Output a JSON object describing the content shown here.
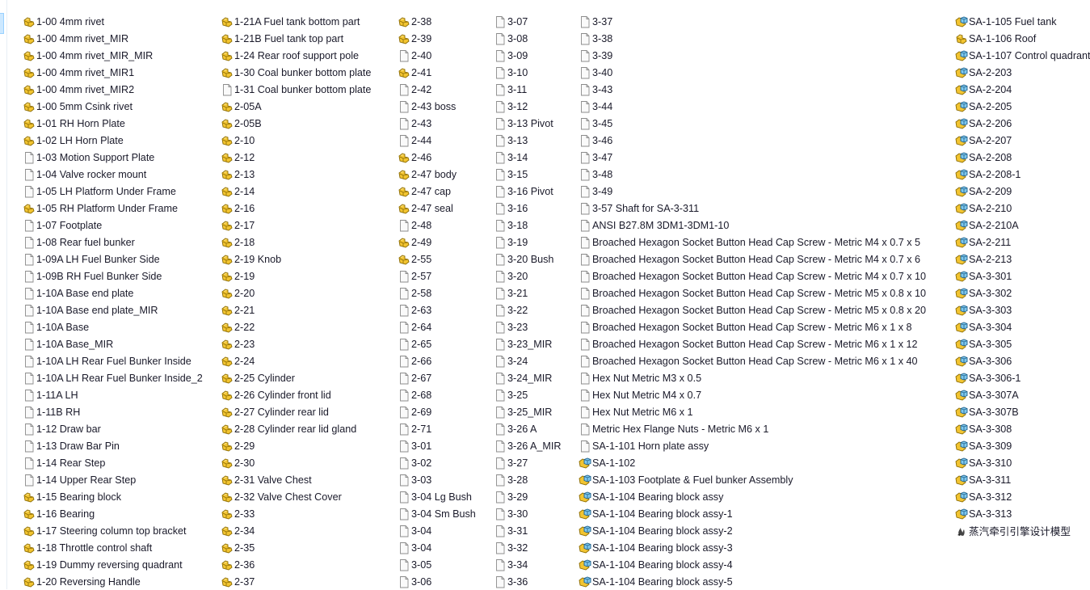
{
  "colors": {
    "part": "#e8b820",
    "assembly_cube": "#5ab4e0",
    "text": "#1a1a2a",
    "selection": "#cce8ff"
  },
  "columns": [
    [
      {
        "name": "1-00 4mm rivet",
        "icon": "part"
      },
      {
        "name": "1-00 4mm rivet_MIR",
        "icon": "part"
      },
      {
        "name": "1-00 4mm rivet_MIR_MIR",
        "icon": "part"
      },
      {
        "name": "1-00 4mm rivet_MIR1",
        "icon": "part"
      },
      {
        "name": "1-00 4mm rivet_MIR2",
        "icon": "part"
      },
      {
        "name": "1-00 5mm Csink rivet",
        "icon": "part"
      },
      {
        "name": "1-01 RH Horn Plate",
        "icon": "part"
      },
      {
        "name": "1-02 LH Horn Plate",
        "icon": "part"
      },
      {
        "name": "1-03 Motion Support Plate",
        "icon": "doc"
      },
      {
        "name": "1-04 Valve rocker mount",
        "icon": "doc"
      },
      {
        "name": "1-05 LH Platform Under Frame",
        "icon": "doc"
      },
      {
        "name": "1-05 RH Platform Under Frame",
        "icon": "part"
      },
      {
        "name": "1-07 Footplate",
        "icon": "doc"
      },
      {
        "name": "1-08 Rear fuel bunker",
        "icon": "doc"
      },
      {
        "name": "1-09A LH Fuel Bunker Side",
        "icon": "doc"
      },
      {
        "name": "1-09B RH Fuel Bunker Side",
        "icon": "doc"
      },
      {
        "name": "1-10A Base end plate",
        "icon": "doc"
      },
      {
        "name": "1-10A Base end plate_MIR",
        "icon": "doc"
      },
      {
        "name": "1-10A Base",
        "icon": "doc"
      },
      {
        "name": "1-10A Base_MIR",
        "icon": "doc"
      },
      {
        "name": "1-10A LH Rear Fuel Bunker Inside",
        "icon": "doc"
      },
      {
        "name": "1-10A LH Rear Fuel Bunker Inside_2",
        "icon": "doc"
      },
      {
        "name": "1-11A LH",
        "icon": "doc"
      },
      {
        "name": "1-11B RH",
        "icon": "doc"
      },
      {
        "name": "1-12 Draw bar",
        "icon": "doc"
      },
      {
        "name": "1-13 Draw Bar Pin",
        "icon": "doc"
      },
      {
        "name": "1-14 Rear Step",
        "icon": "doc"
      },
      {
        "name": "1-14 Upper Rear Step",
        "icon": "doc"
      },
      {
        "name": "1-15 Bearing block",
        "icon": "part"
      },
      {
        "name": "1-16 Bearing",
        "icon": "part"
      },
      {
        "name": "1-17 Steering column top bracket",
        "icon": "part"
      },
      {
        "name": "1-18 Throttle control shaft",
        "icon": "part"
      },
      {
        "name": "1-19 Dummy reversing quadrant",
        "icon": "part"
      },
      {
        "name": "1-20 Reversing Handle",
        "icon": "part"
      }
    ],
    [
      {
        "name": "1-21A Fuel tank bottom part",
        "icon": "part"
      },
      {
        "name": "1-21B Fuel tank top part",
        "icon": "part"
      },
      {
        "name": "1-24 Rear roof support pole",
        "icon": "part"
      },
      {
        "name": "1-30 Coal bunker bottom plate",
        "icon": "part"
      },
      {
        "name": "1-31 Coal bunker bottom plate",
        "icon": "doc"
      },
      {
        "name": "2-05A",
        "icon": "part"
      },
      {
        "name": "2-05B",
        "icon": "part"
      },
      {
        "name": "2-10",
        "icon": "part"
      },
      {
        "name": "2-12",
        "icon": "part"
      },
      {
        "name": "2-13",
        "icon": "part"
      },
      {
        "name": "2-14",
        "icon": "part"
      },
      {
        "name": "2-16",
        "icon": "part"
      },
      {
        "name": "2-17",
        "icon": "part"
      },
      {
        "name": "2-18",
        "icon": "part"
      },
      {
        "name": "2-19 Knob",
        "icon": "part"
      },
      {
        "name": "2-19",
        "icon": "part"
      },
      {
        "name": "2-20",
        "icon": "part"
      },
      {
        "name": "2-21",
        "icon": "part"
      },
      {
        "name": "2-22",
        "icon": "part"
      },
      {
        "name": "2-23",
        "icon": "part"
      },
      {
        "name": "2-24",
        "icon": "part"
      },
      {
        "name": "2-25 Cylinder",
        "icon": "part"
      },
      {
        "name": "2-26 Cylinder front lid",
        "icon": "part"
      },
      {
        "name": "2-27 Cylinder rear lid",
        "icon": "part"
      },
      {
        "name": "2-28 Cylinder rear lid gland",
        "icon": "part"
      },
      {
        "name": "2-29",
        "icon": "part"
      },
      {
        "name": "2-30",
        "icon": "part"
      },
      {
        "name": "2-31 Valve Chest",
        "icon": "part"
      },
      {
        "name": "2-32 Valve Chest Cover",
        "icon": "part"
      },
      {
        "name": "2-33",
        "icon": "part"
      },
      {
        "name": "2-34",
        "icon": "part"
      },
      {
        "name": "2-35",
        "icon": "part"
      },
      {
        "name": "2-36",
        "icon": "part"
      },
      {
        "name": "2-37",
        "icon": "part"
      }
    ],
    [
      {
        "name": "2-38",
        "icon": "part"
      },
      {
        "name": "2-39",
        "icon": "part"
      },
      {
        "name": "2-40",
        "icon": "doc"
      },
      {
        "name": "2-41",
        "icon": "part"
      },
      {
        "name": "2-42",
        "icon": "doc"
      },
      {
        "name": "2-43 boss",
        "icon": "doc"
      },
      {
        "name": "2-43",
        "icon": "doc"
      },
      {
        "name": "2-44",
        "icon": "doc"
      },
      {
        "name": "2-46",
        "icon": "part"
      },
      {
        "name": "2-47 body",
        "icon": "part"
      },
      {
        "name": "2-47 cap",
        "icon": "part"
      },
      {
        "name": "2-47 seal",
        "icon": "part"
      },
      {
        "name": "2-48",
        "icon": "doc"
      },
      {
        "name": "2-49",
        "icon": "part"
      },
      {
        "name": "2-55",
        "icon": "part"
      },
      {
        "name": "2-57",
        "icon": "doc"
      },
      {
        "name": "2-58",
        "icon": "doc"
      },
      {
        "name": "2-63",
        "icon": "doc"
      },
      {
        "name": "2-64",
        "icon": "doc"
      },
      {
        "name": "2-65",
        "icon": "doc"
      },
      {
        "name": "2-66",
        "icon": "doc"
      },
      {
        "name": "2-67",
        "icon": "doc"
      },
      {
        "name": "2-68",
        "icon": "doc"
      },
      {
        "name": "2-69",
        "icon": "doc"
      },
      {
        "name": "2-71",
        "icon": "doc"
      },
      {
        "name": "3-01",
        "icon": "doc"
      },
      {
        "name": "3-02",
        "icon": "doc"
      },
      {
        "name": "3-03",
        "icon": "doc"
      },
      {
        "name": "3-04 Lg Bush",
        "icon": "doc"
      },
      {
        "name": "3-04 Sm Bush",
        "icon": "doc"
      },
      {
        "name": "3-04",
        "icon": "doc"
      },
      {
        "name": "3-04",
        "icon": "doc"
      },
      {
        "name": "3-05",
        "icon": "doc"
      },
      {
        "name": "3-06",
        "icon": "doc"
      }
    ],
    [
      {
        "name": "3-07",
        "icon": "doc"
      },
      {
        "name": "3-08",
        "icon": "doc"
      },
      {
        "name": "3-09",
        "icon": "doc"
      },
      {
        "name": "3-10",
        "icon": "doc"
      },
      {
        "name": "3-11",
        "icon": "doc"
      },
      {
        "name": "3-12",
        "icon": "doc"
      },
      {
        "name": "3-13 Pivot",
        "icon": "doc"
      },
      {
        "name": "3-13",
        "icon": "doc"
      },
      {
        "name": "3-14",
        "icon": "doc"
      },
      {
        "name": "3-15",
        "icon": "doc"
      },
      {
        "name": "3-16 Pivot",
        "icon": "doc"
      },
      {
        "name": "3-16",
        "icon": "doc"
      },
      {
        "name": "3-18",
        "icon": "doc"
      },
      {
        "name": "3-19",
        "icon": "doc"
      },
      {
        "name": "3-20 Bush",
        "icon": "doc"
      },
      {
        "name": "3-20",
        "icon": "doc"
      },
      {
        "name": "3-21",
        "icon": "doc"
      },
      {
        "name": "3-22",
        "icon": "doc"
      },
      {
        "name": "3-23",
        "icon": "doc"
      },
      {
        "name": "3-23_MIR",
        "icon": "doc"
      },
      {
        "name": "3-24",
        "icon": "doc"
      },
      {
        "name": "3-24_MIR",
        "icon": "doc"
      },
      {
        "name": "3-25",
        "icon": "doc"
      },
      {
        "name": "3-25_MIR",
        "icon": "doc"
      },
      {
        "name": "3-26 A",
        "icon": "doc"
      },
      {
        "name": "3-26 A_MIR",
        "icon": "doc"
      },
      {
        "name": "3-27",
        "icon": "doc"
      },
      {
        "name": "3-28",
        "icon": "doc"
      },
      {
        "name": "3-29",
        "icon": "doc"
      },
      {
        "name": "3-30",
        "icon": "doc"
      },
      {
        "name": "3-31",
        "icon": "doc"
      },
      {
        "name": "3-32",
        "icon": "doc"
      },
      {
        "name": "3-34",
        "icon": "doc"
      },
      {
        "name": "3-36",
        "icon": "doc"
      }
    ],
    [
      {
        "name": "3-37",
        "icon": "doc"
      },
      {
        "name": "3-38",
        "icon": "doc"
      },
      {
        "name": "3-39",
        "icon": "doc"
      },
      {
        "name": "3-40",
        "icon": "doc"
      },
      {
        "name": "3-43",
        "icon": "doc"
      },
      {
        "name": "3-44",
        "icon": "doc"
      },
      {
        "name": "3-45",
        "icon": "doc"
      },
      {
        "name": "3-46",
        "icon": "doc"
      },
      {
        "name": "3-47",
        "icon": "doc"
      },
      {
        "name": "3-48",
        "icon": "doc"
      },
      {
        "name": "3-49",
        "icon": "doc"
      },
      {
        "name": "3-57 Shaft for SA-3-311",
        "icon": "doc"
      },
      {
        "name": "ANSI B27.8M 3DM1-3DM1-10",
        "icon": "doc"
      },
      {
        "name": "Broached Hexagon Socket Button Head Cap Screw - Metric M4 x 0.7 x 5",
        "icon": "doc"
      },
      {
        "name": "Broached Hexagon Socket Button Head Cap Screw - Metric M4 x 0.7 x 6",
        "icon": "doc"
      },
      {
        "name": "Broached Hexagon Socket Button Head Cap Screw - Metric M4 x 0.7 x 10",
        "icon": "doc"
      },
      {
        "name": "Broached Hexagon Socket Button Head Cap Screw - Metric M5 x 0.8 x 10",
        "icon": "doc"
      },
      {
        "name": "Broached Hexagon Socket Button Head Cap Screw - Metric M5 x 0.8 x 20",
        "icon": "doc"
      },
      {
        "name": "Broached Hexagon Socket Button Head Cap Screw - Metric M6 x 1 x 8",
        "icon": "doc"
      },
      {
        "name": "Broached Hexagon Socket Button Head Cap Screw - Metric M6 x 1 x 12",
        "icon": "doc"
      },
      {
        "name": "Broached Hexagon Socket Button Head Cap Screw - Metric M6 x 1 x 40",
        "icon": "doc"
      },
      {
        "name": "Hex Nut Metric M3 x 0.5",
        "icon": "doc"
      },
      {
        "name": "Hex Nut Metric M4 x 0.7",
        "icon": "doc"
      },
      {
        "name": "Hex Nut Metric M6 x 1",
        "icon": "doc"
      },
      {
        "name": "Metric Hex Flange Nuts - Metric M6 x 1",
        "icon": "doc"
      },
      {
        "name": "SA-1-101 Horn plate assy",
        "icon": "doc"
      },
      {
        "name": "SA-1-102",
        "icon": "assembly"
      },
      {
        "name": "SA-1-103 Footplate & Fuel bunker Assembly",
        "icon": "assembly"
      },
      {
        "name": "SA-1-104 Bearing block assy",
        "icon": "assembly"
      },
      {
        "name": "SA-1-104 Bearing block assy-1",
        "icon": "assembly"
      },
      {
        "name": "SA-1-104 Bearing block assy-2",
        "icon": "assembly"
      },
      {
        "name": "SA-1-104 Bearing block assy-3",
        "icon": "assembly"
      },
      {
        "name": "SA-1-104 Bearing block assy-4",
        "icon": "assembly"
      },
      {
        "name": "SA-1-104 Bearing block assy-5",
        "icon": "assembly"
      }
    ],
    [
      {
        "name": "SA-1-105 Fuel tank",
        "icon": "assembly"
      },
      {
        "name": "SA-1-106 Roof",
        "icon": "part"
      },
      {
        "name": "SA-1-107 Control quadrant",
        "icon": "assembly"
      },
      {
        "name": "SA-2-203",
        "icon": "assembly"
      },
      {
        "name": "SA-2-204",
        "icon": "assembly"
      },
      {
        "name": "SA-2-205",
        "icon": "assembly"
      },
      {
        "name": "SA-2-206",
        "icon": "assembly"
      },
      {
        "name": "SA-2-207",
        "icon": "assembly"
      },
      {
        "name": "SA-2-208",
        "icon": "assembly"
      },
      {
        "name": "SA-2-208-1",
        "icon": "assembly"
      },
      {
        "name": "SA-2-209",
        "icon": "assembly"
      },
      {
        "name": "SA-2-210",
        "icon": "assembly"
      },
      {
        "name": "SA-2-210A",
        "icon": "assembly"
      },
      {
        "name": "SA-2-211",
        "icon": "assembly"
      },
      {
        "name": "SA-2-213",
        "icon": "assembly"
      },
      {
        "name": "SA-3-301",
        "icon": "assembly"
      },
      {
        "name": "SA-3-302",
        "icon": "assembly"
      },
      {
        "name": "SA-3-303",
        "icon": "assembly"
      },
      {
        "name": "SA-3-304",
        "icon": "assembly"
      },
      {
        "name": "SA-3-305",
        "icon": "assembly"
      },
      {
        "name": "SA-3-306",
        "icon": "assembly"
      },
      {
        "name": "SA-3-306-1",
        "icon": "assembly"
      },
      {
        "name": "SA-3-307A",
        "icon": "assembly"
      },
      {
        "name": "SA-3-307B",
        "icon": "assembly"
      },
      {
        "name": "SA-3-308",
        "icon": "assembly"
      },
      {
        "name": "SA-3-309",
        "icon": "assembly"
      },
      {
        "name": "SA-3-310",
        "icon": "assembly"
      },
      {
        "name": "SA-3-311",
        "icon": "assembly"
      },
      {
        "name": "SA-3-312",
        "icon": "assembly"
      },
      {
        "name": "SA-3-313",
        "icon": "assembly"
      },
      {
        "name": "蒸汽牵引引擎设计模型",
        "icon": "shortcut"
      }
    ]
  ]
}
